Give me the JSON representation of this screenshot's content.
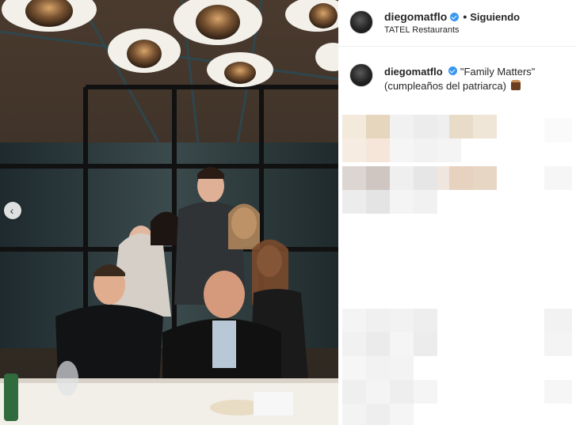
{
  "post": {
    "username": "diegomatflo",
    "verified": true,
    "follow_status": "Siguiendo",
    "location": "TATEL Restaurants",
    "caption_text": "\"Family Matters\" (cumpleaños del patriarca)",
    "caption_emoji": "cake-icon"
  },
  "colors": {
    "verified_blue": "#3897f0",
    "photo_warm": "#3a2f28",
    "pixel_beige": "#e6d6bd"
  }
}
